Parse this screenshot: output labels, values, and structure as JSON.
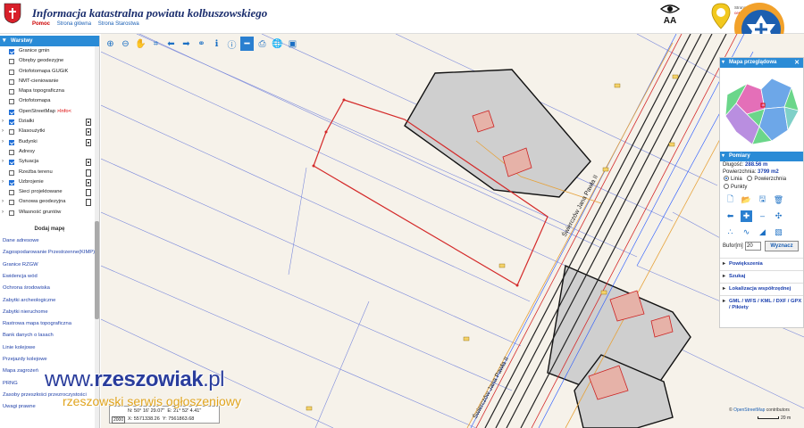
{
  "header": {
    "title": "Informacja katastralna powiatu kolbuszowskiego",
    "links": {
      "help": "Pomoc",
      "main": "Strona główna",
      "starostwo": "Strona Starostwa"
    },
    "font_size_label": "AA",
    "geo_badge_text_1": "Strona ma",
    "geo_badge_text_2": "certyfikat"
  },
  "layers_panel": {
    "title": "Warstwy",
    "layers": [
      {
        "label": "Granice gmin",
        "checked": true,
        "expandable": false,
        "doc": ""
      },
      {
        "label": "Obręby geodezyjne",
        "checked": false,
        "expandable": false,
        "doc": ""
      },
      {
        "label": "Ortofotomapa GUGiK",
        "checked": false,
        "expandable": false,
        "doc": ""
      },
      {
        "label": "NMT-cieniowanie",
        "checked": false,
        "expandable": false,
        "doc": ""
      },
      {
        "label": "Mapa topograficzna",
        "checked": false,
        "expandable": false,
        "doc": ""
      },
      {
        "label": "Ortofotomapa",
        "checked": false,
        "expandable": false,
        "doc": ""
      },
      {
        "label": "OpenStreetMap",
        "info": ">Info<",
        "checked": true,
        "expandable": false,
        "doc": ""
      },
      {
        "label": "Działki",
        "checked": true,
        "expandable": true,
        "doc": "filled"
      },
      {
        "label": "Klasoużytki",
        "checked": false,
        "expandable": true,
        "doc": "filled"
      },
      {
        "label": "Budynki",
        "checked": true,
        "expandable": true,
        "doc": "filled"
      },
      {
        "label": "Adresy",
        "checked": false,
        "expandable": false,
        "doc": ""
      },
      {
        "label": "Sytuacja",
        "checked": true,
        "expandable": true,
        "doc": "filled"
      },
      {
        "label": "Rzeźba terenu",
        "checked": false,
        "expandable": false,
        "doc": "empty"
      },
      {
        "label": "Uzbrojenie",
        "checked": true,
        "expandable": true,
        "doc": "filled"
      },
      {
        "label": "Sieci projektowane",
        "checked": false,
        "expandable": false,
        "doc": "empty"
      },
      {
        "label": "Osnowa geodezyjna",
        "checked": false,
        "expandable": true,
        "doc": "empty"
      },
      {
        "label": "Własność gruntów",
        "checked": false,
        "expandable": true,
        "doc": ""
      }
    ],
    "add_map_label": "Dodaj mapę",
    "extra_maps": [
      "Dane adresowe",
      "Zagospodarowanie Przestrzenne(KIMP)",
      "Granice RZGW",
      "Ewidencja wód",
      "Ochrona środowiska",
      "Zabytki archeologiczne",
      "Zabytki nieruchome",
      "Rastrowa mapa topograficzna",
      "Bank danych o lasach",
      "Linie kolejowe",
      "Przejazdy kolejowe",
      "Mapa zagrożeń",
      "PRNG",
      "Zasoby przeszłości przezroczystości",
      "Uwagi prawne"
    ]
  },
  "toolbar": {
    "tools": [
      "zoom-in-icon",
      "zoom-out-icon",
      "pan-hand-icon",
      "zoom-box-icon",
      "back-arrow-icon",
      "forward-arrow-icon",
      "link-icon",
      "info-icon",
      "feature-info-icon",
      "measure-icon",
      "print-icon",
      "globe-icon",
      "video-icon"
    ],
    "active_index": 9
  },
  "map": {
    "road_label_1": "Świerczów Jana Pawła II",
    "road_label_2": "Świerczów Jana Pawła II",
    "coords": {
      "system": "2000",
      "lat_label": "N:",
      "lat_value": "50° 16' 29.07\"",
      "lon_label": "E:",
      "lon_value": "21° 52' 4.41\"",
      "x_label": "X:",
      "x_value": "5571338.26",
      "y_label": "Y:",
      "y_value": "7561863.68"
    },
    "attribution_prefix": "© ",
    "attribution_link": "OpenStreetMap",
    "attribution_suffix": " contributors",
    "scale_label": "20 m"
  },
  "right_panel": {
    "overview_title": "Mapa przeglądowa",
    "measure_title": "Pomiary",
    "length_label": "Długość:",
    "length_value": "288.56 m",
    "area_label": "Powierzchnia:",
    "area_value": "3799 m2",
    "modes": [
      {
        "label": "Linia",
        "selected": true
      },
      {
        "label": "Powierzchnia",
        "selected": false
      },
      {
        "label": "Punkty",
        "selected": false
      }
    ],
    "bufor_label": "Bufor[m]",
    "bufor_value": "20",
    "bufor_button": "Wyznacz",
    "sections": [
      "Powiększenia",
      "Szukaj",
      "Lokalizacja współrzędnej",
      "GML / WFS / KML / DXF / GPX / Pikiety"
    ]
  },
  "watermark": {
    "line1_prefix": "www.",
    "line1_main": "rzeszowiak",
    "line1_suffix": ".pl",
    "line2": "rzeszowski serwis ogłoszeniowy"
  },
  "colors": {
    "header_blue": "#1a2d6d",
    "panel_blue": "#2a8bd6",
    "parcel_red": "#d42a2a",
    "watermark_blue": "#2a3d9c",
    "watermark_orange": "#e0a41e"
  }
}
